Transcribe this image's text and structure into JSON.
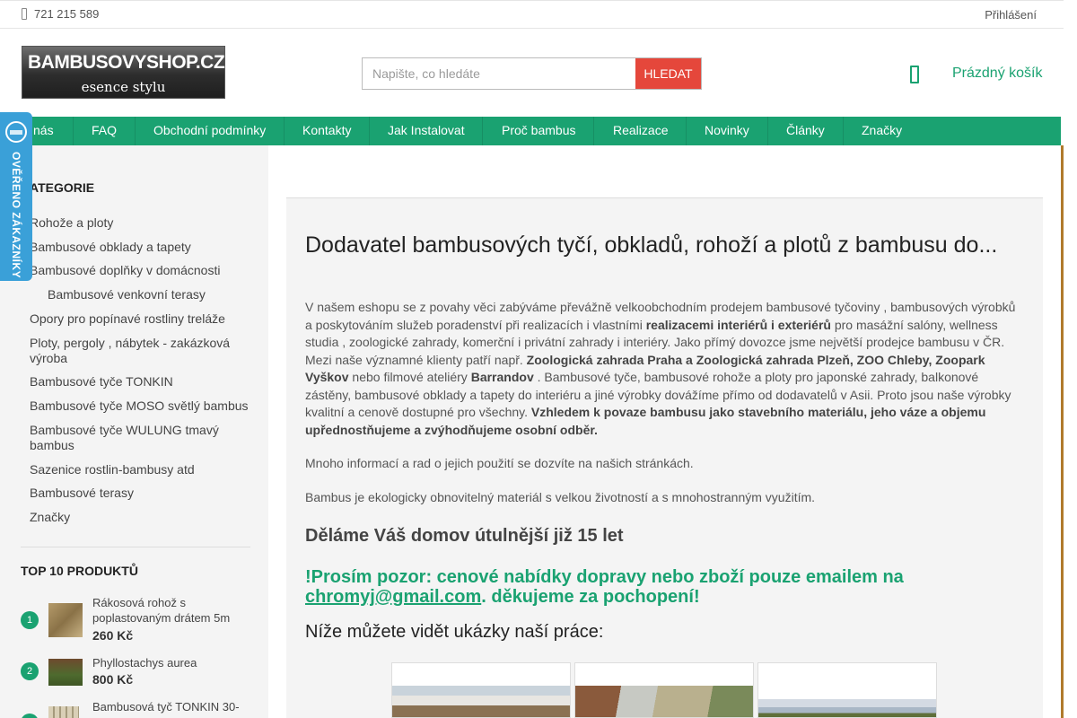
{
  "topbar": {
    "phone": "721 215 589",
    "login": "Přihlášení"
  },
  "logo": {
    "line1a": "BAMBUSOVY",
    "line1b": "SHOP.CZ",
    "line2": "esence stylu"
  },
  "search": {
    "placeholder": "Napište, co hledáte",
    "button": "HLEDAT"
  },
  "cart": {
    "label": "Prázdný košík",
    "icon": "phone-bag-icon"
  },
  "nav": [
    "nás",
    "FAQ",
    "Obchodní podmínky",
    "Kontakty",
    "Jak Instalovat",
    "Proč bambus",
    "Realizace",
    "Novinky",
    "Články",
    "Značky"
  ],
  "badge": {
    "text": "OVĚŘENO ZÁKAZNÍKY"
  },
  "sidebar": {
    "heading": "ATEGORIE",
    "categories": [
      "Rohože a ploty",
      "Bambusové obklady a tapety",
      "Bambusové doplňky v domácnosti",
      "Bambusové venkovní terasy",
      "Opory pro popínavé rostliny treláže",
      "Ploty, pergoly , nábytek - zakázková výroba",
      "Bambusové tyče TONKIN",
      "Bambusové tyče MOSO světlý bambus",
      "Bambusové tyče WULUNG tmavý bambus",
      "Sazenice rostlin-bambusy atd",
      "Bambusové terasy",
      "Značky"
    ],
    "top10_heading": "TOP 10 PRODUKTŮ",
    "products": [
      {
        "num": "1",
        "name": "Rákosová rohož s poplastovaným drátem 5m",
        "price": "260 Kč"
      },
      {
        "num": "2",
        "name": "Phyllostachys aurea",
        "price": "800 Kč"
      },
      {
        "num": "3",
        "name": "Bambusová tyč TONKIN 30-",
        "price": ""
      }
    ]
  },
  "main": {
    "title": "Dodavatel bambusových tyčí, obkladů, rohoží a plotů z bambusu do...",
    "p1_a": "V našem eshopu se z povahy věci  zabýváme převážně velkoobchodním prodejem bambusové tyčoviny , bambusových výrobků a poskytováním služeb poradenství při realizacích i vlastními ",
    "p1_b": "realizacemi interiérů i exteriérů",
    "p1_c": " pro  masážní salóny, wellness studia , zoologické zahrady, komerční i privátní zahrady i interiéry. Jako přímý dovozce jsme největší prodejce bambusu v ČR. Mezi naše významné klienty patří např. ",
    "p1_d": "Zoologická zahrada Praha a Zoologická zahrada Plzeň, ZOO Chleby, Zoopark Vyškov",
    "p1_e": " nebo filmové ateliéry ",
    "p1_f": "Barrandov",
    "p1_g": "  . Bambusové tyče, bambusové rohože a ploty pro japonské zahrady, balkonové zástěny, bambusové obklady a  tapety  do interiéru a  jiné výrobky dovážíme přímo od dodavatelů v Asii. Proto jsou naše výrobky kvalitní a cenově dostupné pro všechny. ",
    "p1_h": "Vzhledem k povaze bambusu jako stavebního materiálu, jeho váze a  objemu upřednostňujeme a zvýhodňujeme osobní odběr.",
    "p2": "Mnoho informací a rad o jejich použití se dozvíte na našich stránkách.",
    "p3": "Bambus je ekologicky obnovitelný materiál s velkou  životností a s mnohostranným využitím.",
    "h2": "Děláme Váš domov útulnější již 15 let",
    "notice_a": "!Prosím pozor: cenové nabídky dopravy  nebo zboží  pouze  emailem na ",
    "notice_email": "chromyj@gmail.com",
    "notice_b": ". děkujeme za pochopení!",
    "gallery_heading": "Níže můžete vidět ukázky naší práce:"
  },
  "colors": {
    "accent": "#1aa271",
    "search_button": "#e5473b",
    "badge": "#3aa0d8"
  }
}
